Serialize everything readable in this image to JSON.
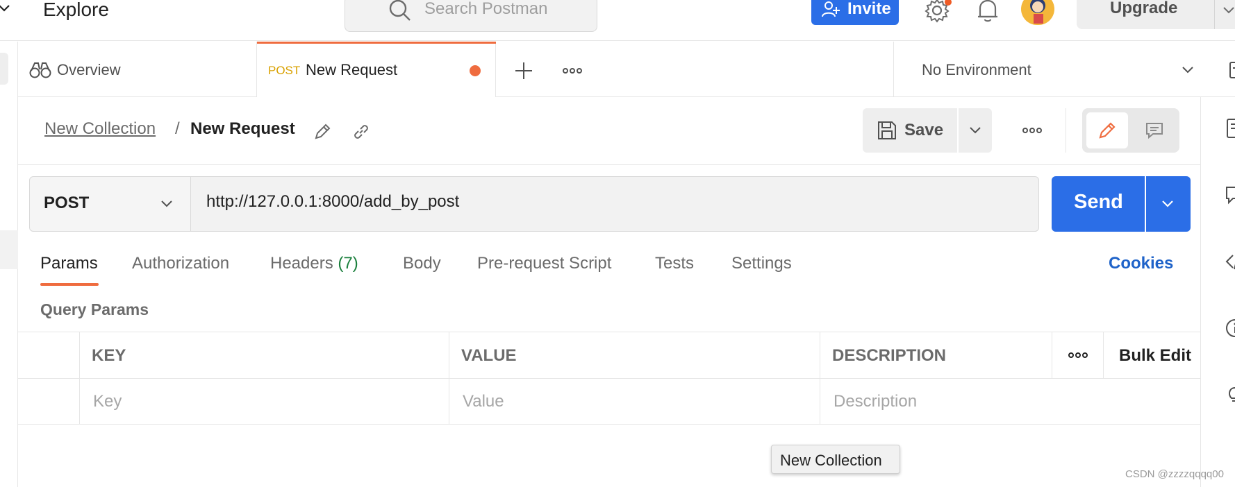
{
  "header": {
    "workspace_label": "Explore",
    "search_placeholder": "Search Postman",
    "invite_label": "Invite",
    "upgrade_label": "Upgrade"
  },
  "tabs": {
    "overview_label": "Overview",
    "active_method": "POST",
    "active_name": "New Request",
    "environment": "No Environment"
  },
  "breadcrumb": {
    "collection": "New Collection",
    "separator": "/",
    "request": "New Request"
  },
  "toolbar": {
    "save_label": "Save"
  },
  "request": {
    "method": "POST",
    "url": "http://127.0.0.1:8000/add_by_post",
    "send_label": "Send"
  },
  "request_tabs": [
    {
      "label": "Params"
    },
    {
      "label": "Authorization"
    },
    {
      "label": "Headers",
      "count": "(7)"
    },
    {
      "label": "Body"
    },
    {
      "label": "Pre-request Script"
    },
    {
      "label": "Tests"
    },
    {
      "label": "Settings"
    }
  ],
  "cookies_label": "Cookies",
  "query_params": {
    "title": "Query Params",
    "columns": [
      "KEY",
      "VALUE",
      "DESCRIPTION"
    ],
    "bulk_edit_label": "Bulk Edit",
    "placeholders": {
      "key": "Key",
      "value": "Value",
      "description": "Description"
    }
  },
  "tooltip": "New Collection",
  "watermark": "CSDN @zzzzqqqq00",
  "colors": {
    "accent": "#ef6c3f",
    "primary": "#2b6ee7",
    "method_post": "#d9a100",
    "headers_count": "#1a7f3c",
    "link": "#1f63c9"
  }
}
